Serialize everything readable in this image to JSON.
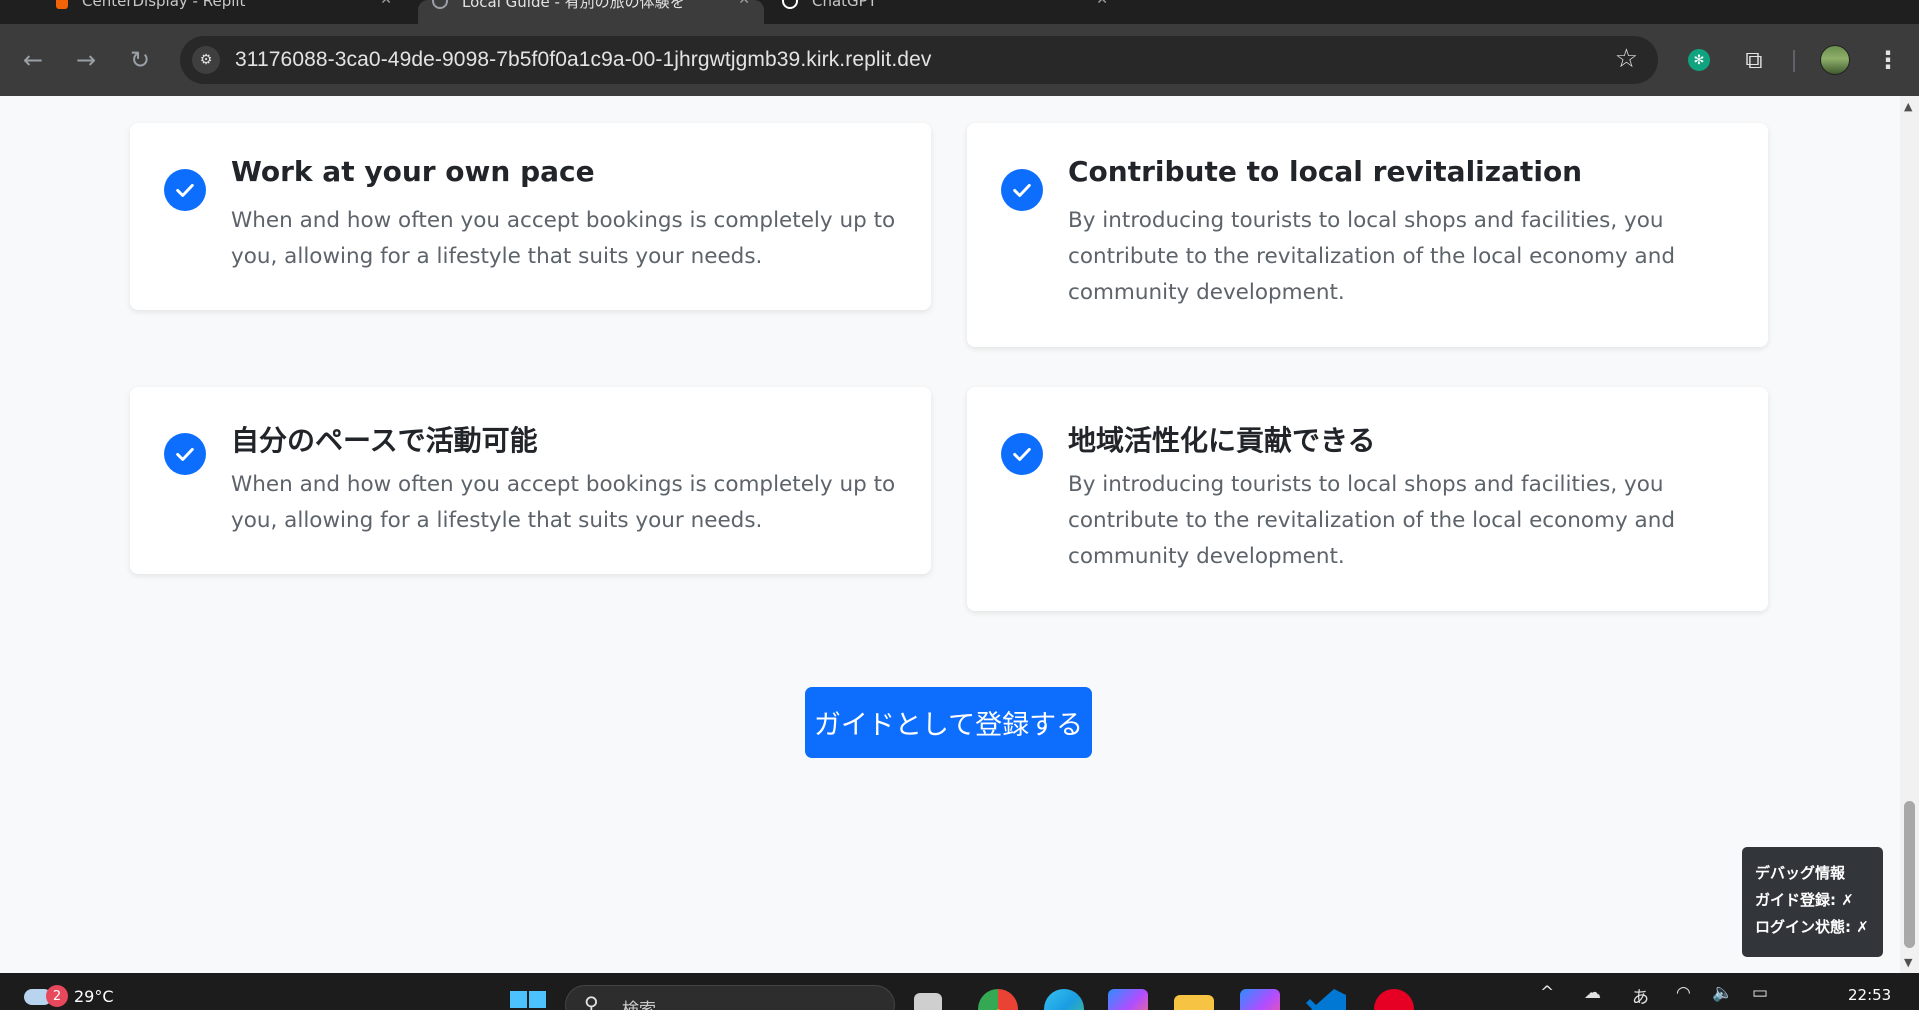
{
  "browser": {
    "tabs": [
      {
        "label": "CenterDisplay - Replit",
        "active": false,
        "favicon_color": "#f26207"
      },
      {
        "label": "Local Guide - 有別の旅の体験を",
        "active": true,
        "favicon_color": "#9aa0a6"
      },
      {
        "label": "ChatGPT",
        "active": false,
        "favicon_color": "#ffffff"
      }
    ],
    "url": "31176088-3ca0-49de-9098-7b5f0f0a1c9a-00-1jhrgwtjgmb39.kirk.replit.dev"
  },
  "page": {
    "benefits": [
      {
        "title": "Work at your own pace",
        "description": "When and how often you accept bookings is completely up to you, allowing for a lifestyle that suits your needs."
      },
      {
        "title": "Contribute to local revitalization",
        "description": "By introducing tourists to local shops and facilities, you contribute to the revitalization of the local economy and community development."
      },
      {
        "title": "自分のペースで活動可能",
        "description": "When and how often you accept bookings is completely up to you, allowing for a lifestyle that suits your needs."
      },
      {
        "title": "地域活性化に貢献できる",
        "description": "By introducing tourists to local shops and facilities, you contribute to the revitalization of the local economy and community development."
      }
    ],
    "cta_label": "ガイドとして登録する",
    "debug": {
      "title": "デバッグ情報",
      "guide_registration": "ガイド登録: ✗",
      "login_status": "ログイン状態: ✗"
    },
    "accent_color": "#0d6efd"
  },
  "taskbar": {
    "weather_temp": "29°C",
    "weather_badge": "2",
    "search_placeholder": "検索",
    "ime_label": "あ",
    "clock_time": "22:53"
  }
}
